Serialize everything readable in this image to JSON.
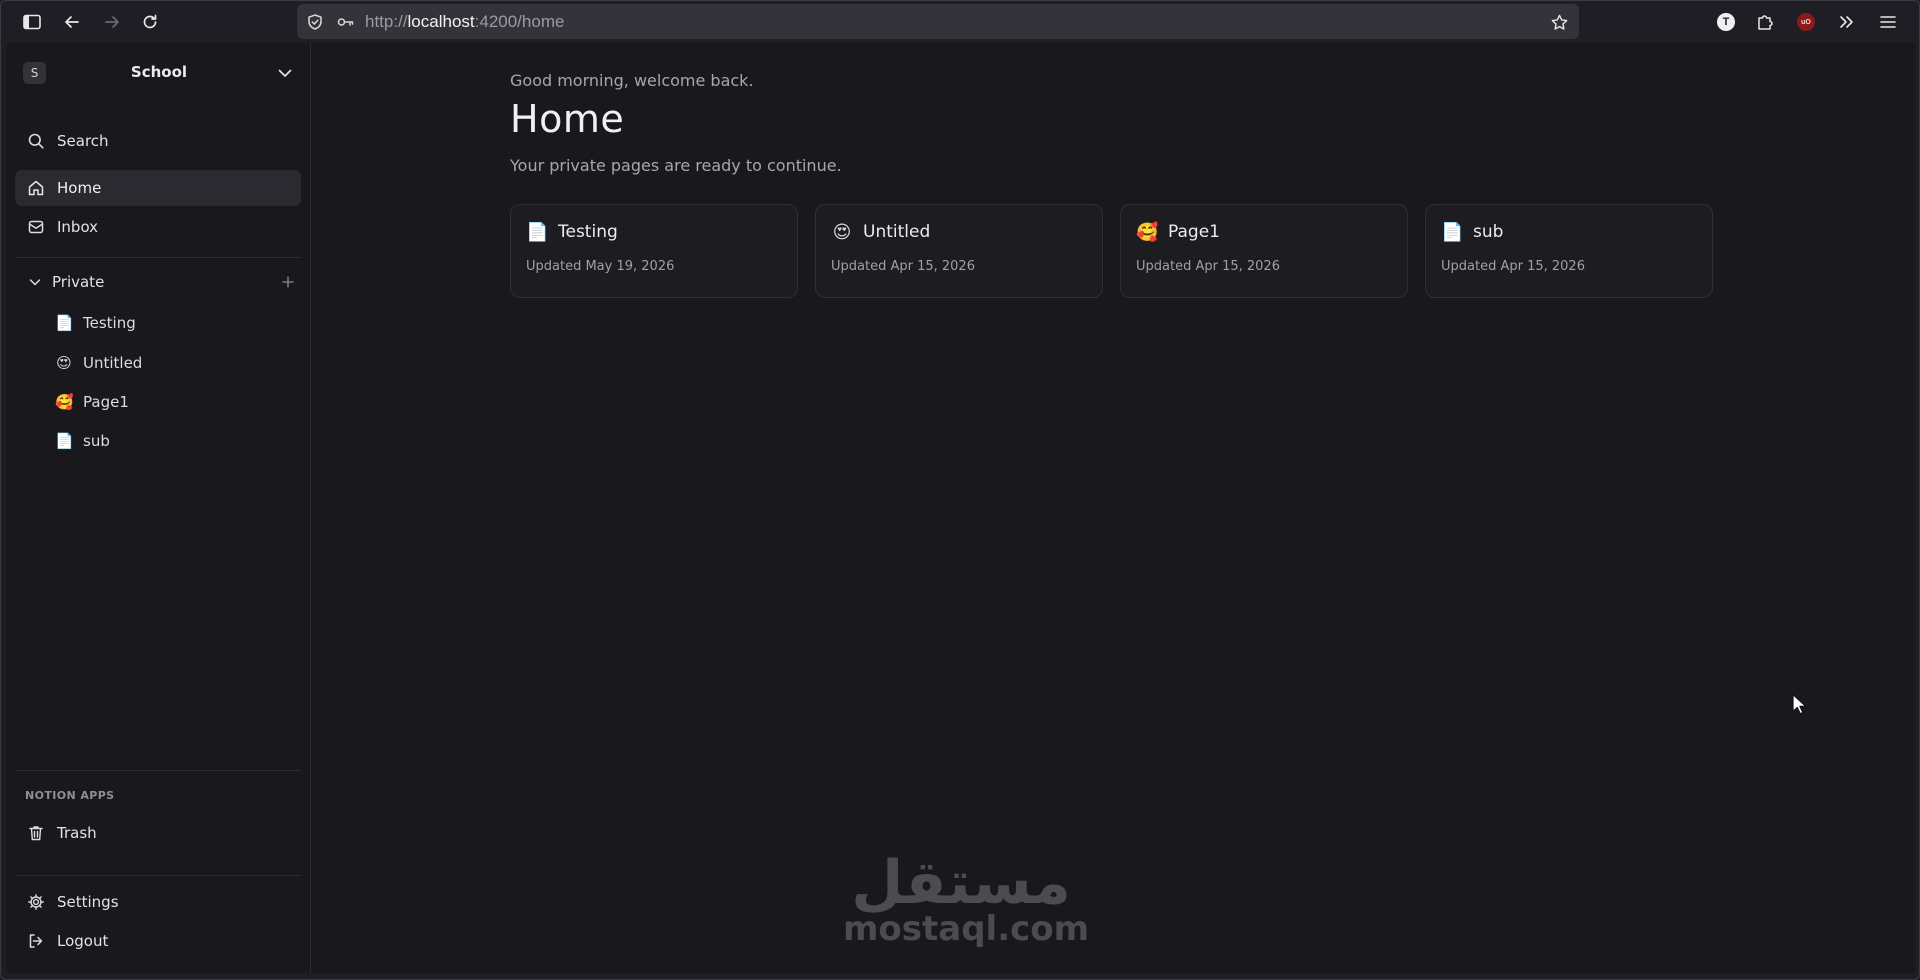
{
  "browser": {
    "url_scheme": "http://",
    "url_host": "localhost",
    "url_path": ":4200/home",
    "extensions": [
      {
        "name": "translate-extension-icon",
        "glyph": "T"
      },
      {
        "name": "ublock-extension-icon",
        "glyph": "uO"
      }
    ]
  },
  "workspace": {
    "avatar_letter": "S",
    "name": "School"
  },
  "nav": {
    "search": "Search",
    "home": "Home",
    "inbox": "Inbox"
  },
  "private_section": {
    "label": "Private",
    "pages": [
      {
        "emoji": "📄",
        "title": "Testing"
      },
      {
        "emoji": "😍",
        "title": "Untitled"
      },
      {
        "emoji": "🥰",
        "title": "Page1"
      },
      {
        "emoji": "📄",
        "title": "sub"
      }
    ]
  },
  "apps_section": {
    "label": "NOTION APPS",
    "trash": "Trash"
  },
  "footer": {
    "settings": "Settings",
    "logout": "Logout"
  },
  "main": {
    "greeting": "Good morning, welcome back.",
    "title": "Home",
    "subtitle": "Your private pages are ready to continue.",
    "cards": [
      {
        "emoji": "📄",
        "title": "Testing",
        "updated": "Updated May 19, 2026"
      },
      {
        "emoji": "😍",
        "title": "Untitled",
        "updated": "Updated Apr 15, 2026"
      },
      {
        "emoji": "🥰",
        "title": "Page1",
        "updated": "Updated Apr 15, 2026"
      },
      {
        "emoji": "📄",
        "title": "sub",
        "updated": "Updated Apr 15, 2026"
      }
    ]
  },
  "watermark": {
    "arabic": "مستقل",
    "latin": "mostaql.com"
  },
  "colors": {
    "background": "#19191d",
    "sidebar_active": "#2a2a30",
    "card_border": "#2e2e34",
    "urlbar": "#34333a"
  }
}
